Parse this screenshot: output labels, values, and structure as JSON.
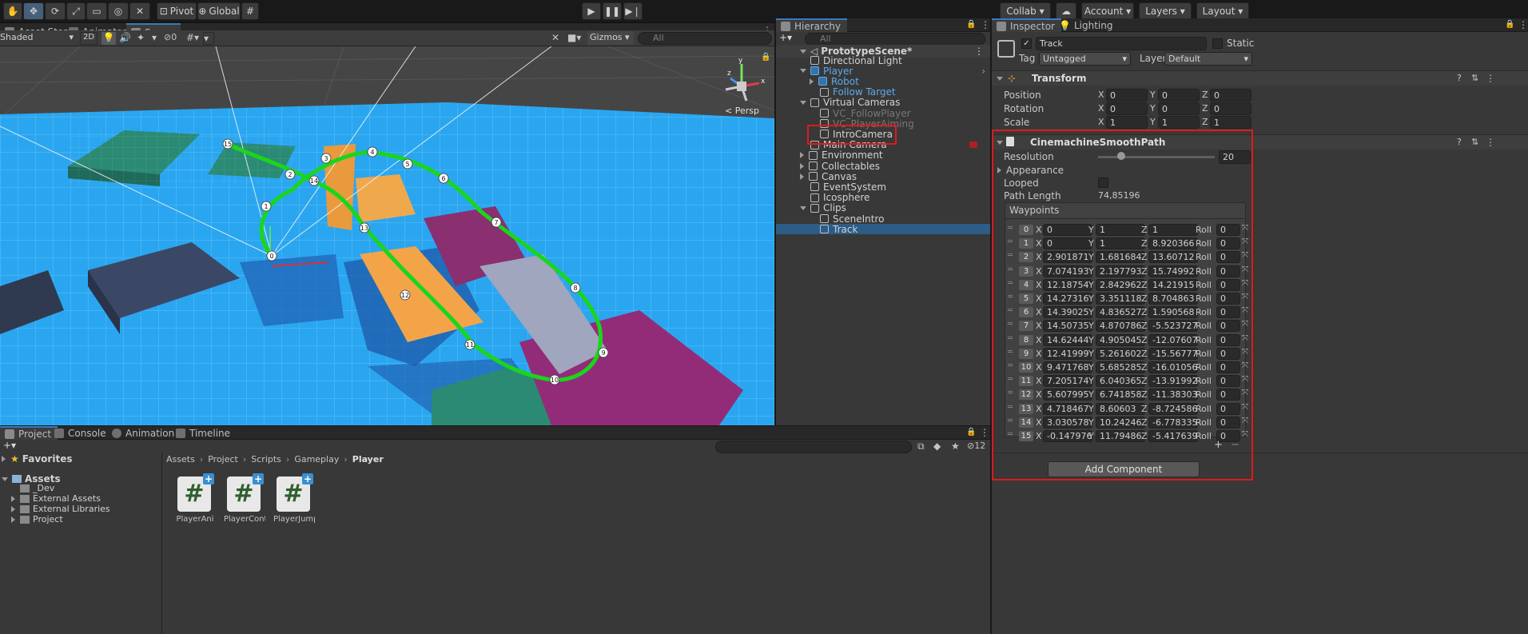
{
  "toolbar": {
    "pivot_label": "Pivot",
    "global_label": "Global",
    "collab_label": "Collab",
    "account_label": "Account",
    "layers_label": "Layers",
    "layout_label": "Layout"
  },
  "scene_tabs": {
    "asset_store": "Asset Store",
    "animator": "Animator",
    "scene": "Scene"
  },
  "scene_toolbar": {
    "shading_mode": "Shaded",
    "mode_2d": "2D",
    "hidden_count": "0",
    "gizmos_label": "Gizmos",
    "search_placeholder": "All",
    "persp_label": "< Persp"
  },
  "path_numbers": [
    "0",
    "1",
    "2",
    "3",
    "4",
    "5",
    "6",
    "7",
    "8",
    "9",
    "10",
    "11",
    "12",
    "13",
    "14",
    "15"
  ],
  "hierarchy": {
    "tab_label": "Hierarchy",
    "search_placeholder": "All",
    "scene_name": "PrototypeScene*",
    "items": [
      {
        "label": "Directional Light"
      },
      {
        "label": "Player"
      },
      {
        "label": "Robot"
      },
      {
        "label": "Follow Target"
      },
      {
        "label": "Virtual Cameras"
      },
      {
        "label": "VC_FollowPlayer"
      },
      {
        "label": "VC_PlayerAiming"
      },
      {
        "label": "IntroCamera"
      },
      {
        "label": "Main Camera"
      },
      {
        "label": "Environment"
      },
      {
        "label": "Collectables"
      },
      {
        "label": "Canvas"
      },
      {
        "label": "EventSystem"
      },
      {
        "label": "Icosphere"
      },
      {
        "label": "Clips"
      },
      {
        "label": "SceneIntro"
      },
      {
        "label": "Track"
      }
    ]
  },
  "inspector": {
    "tab_inspector": "Inspector",
    "tab_lighting": "Lighting",
    "object_name": "Track",
    "static_label": "Static",
    "tag_label": "Tag",
    "tag_value": "Untagged",
    "layer_label": "Layer",
    "layer_value": "Default",
    "transform": {
      "title": "Transform",
      "position_label": "Position",
      "rotation_label": "Rotation",
      "scale_label": "Scale",
      "x": "X",
      "y": "Y",
      "z": "Z",
      "position": [
        "0",
        "0",
        "0"
      ],
      "rotation": [
        "0",
        "0",
        "0"
      ],
      "scale": [
        "1",
        "1",
        "1"
      ]
    },
    "smooth_path": {
      "title": "CinemachineSmoothPath",
      "resolution_label": "Resolution",
      "resolution_value": "20",
      "resolution_fraction": 0.2,
      "appearance_label": "Appearance",
      "looped_label": "Looped",
      "path_length_label": "Path Length",
      "path_length_value": "74,85196",
      "waypoints_label": "Waypoints",
      "roll_label": "Roll",
      "waypoints": [
        {
          "i": "0",
          "x": "0",
          "y": "1",
          "z": "1",
          "roll": "0"
        },
        {
          "i": "1",
          "x": "0",
          "y": "1",
          "z": "8.920366",
          "roll": "0"
        },
        {
          "i": "2",
          "x": "2.901871",
          "y": "1.681684",
          "z": "13.60712",
          "roll": "0"
        },
        {
          "i": "3",
          "x": "7.074193",
          "y": "2.197793",
          "z": "15.74992",
          "roll": "0"
        },
        {
          "i": "4",
          "x": "12.18754",
          "y": "2.842962",
          "z": "14.21915",
          "roll": "0"
        },
        {
          "i": "5",
          "x": "14.27316",
          "y": "3.351118",
          "z": "8.704863",
          "roll": "0"
        },
        {
          "i": "6",
          "x": "14.39025",
          "y": "4.836527",
          "z": "1.590568",
          "roll": "0"
        },
        {
          "i": "7",
          "x": "14.50735",
          "y": "4.870786",
          "z": "-5.523727",
          "roll": "0"
        },
        {
          "i": "8",
          "x": "14.62444",
          "y": "4.905045",
          "z": "-12.07607",
          "roll": "0"
        },
        {
          "i": "9",
          "x": "12.41999",
          "y": "5.261602",
          "z": "-15.56777",
          "roll": "0"
        },
        {
          "i": "10",
          "x": "9.471768",
          "y": "5.685285",
          "z": "-16.01056",
          "roll": "0"
        },
        {
          "i": "11",
          "x": "7.205174",
          "y": "6.040365",
          "z": "-13.91992",
          "roll": "0"
        },
        {
          "i": "12",
          "x": "5.607995",
          "y": "6.741858",
          "z": "-11.38303",
          "roll": "0"
        },
        {
          "i": "13",
          "x": "4.718467",
          "y": "8.60603",
          "z": "-8.724586",
          "roll": "0"
        },
        {
          "i": "14",
          "x": "3.030578",
          "y": "10.24246",
          "z": "-6.778335",
          "roll": "0"
        },
        {
          "i": "15",
          "x": "-0.147976",
          "y": "11.79486",
          "z": "-5.417639",
          "roll": "0"
        }
      ]
    },
    "add_component": "Add Component"
  },
  "project": {
    "tab_project": "Project",
    "tab_console": "Console",
    "tab_animation": "Animation",
    "tab_timeline": "Timeline",
    "hidden_count": "12",
    "favorites": "Favorites",
    "assets": "Assets",
    "tree": [
      "_Dev",
      "External Assets",
      "External Libraries",
      "Project"
    ],
    "breadcrumb": [
      "Assets",
      "Project",
      "Scripts",
      "Gameplay",
      "Player"
    ],
    "files": [
      "PlayerAni",
      "PlayerCont",
      "PlayerJump"
    ]
  },
  "colors": {
    "accent": "#3a79bb",
    "highlight_red": "#e01a1a",
    "path_green": "#19d61b",
    "floor_blue": "#2aa6f0"
  }
}
